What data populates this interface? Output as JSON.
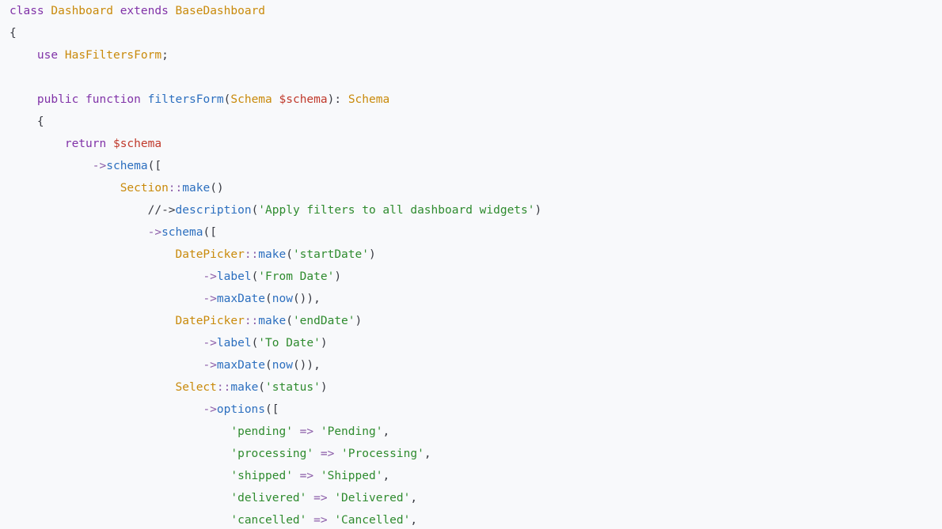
{
  "code": {
    "language": "php",
    "lines": [
      [
        {
          "t": "class",
          "c": "kw"
        },
        {
          "t": " ",
          "c": "punct"
        },
        {
          "t": "Dashboard",
          "c": "type"
        },
        {
          "t": " ",
          "c": "punct"
        },
        {
          "t": "extends",
          "c": "kw"
        },
        {
          "t": " ",
          "c": "punct"
        },
        {
          "t": "BaseDashboard",
          "c": "type"
        }
      ],
      [
        {
          "t": "{",
          "c": "punct"
        }
      ],
      [
        {
          "t": "    ",
          "c": "punct"
        },
        {
          "t": "use",
          "c": "kw"
        },
        {
          "t": " ",
          "c": "punct"
        },
        {
          "t": "HasFiltersForm",
          "c": "type"
        },
        {
          "t": ";",
          "c": "punct"
        }
      ],
      [],
      [
        {
          "t": "    ",
          "c": "punct"
        },
        {
          "t": "public",
          "c": "kw"
        },
        {
          "t": " ",
          "c": "punct"
        },
        {
          "t": "function",
          "c": "kw"
        },
        {
          "t": " ",
          "c": "punct"
        },
        {
          "t": "filtersForm",
          "c": "fn"
        },
        {
          "t": "(",
          "c": "punct"
        },
        {
          "t": "Schema",
          "c": "type"
        },
        {
          "t": " ",
          "c": "punct"
        },
        {
          "t": "$schema",
          "c": "var"
        },
        {
          "t": "): ",
          "c": "punct"
        },
        {
          "t": "Schema",
          "c": "type"
        }
      ],
      [
        {
          "t": "    {",
          "c": "punct"
        }
      ],
      [
        {
          "t": "        ",
          "c": "punct"
        },
        {
          "t": "return",
          "c": "kw"
        },
        {
          "t": " ",
          "c": "punct"
        },
        {
          "t": "$schema",
          "c": "var"
        }
      ],
      [
        {
          "t": "            ",
          "c": "punct"
        },
        {
          "t": "->",
          "c": "op"
        },
        {
          "t": "schema",
          "c": "fn"
        },
        {
          "t": "([",
          "c": "punct"
        }
      ],
      [
        {
          "t": "                ",
          "c": "punct"
        },
        {
          "t": "Section",
          "c": "type"
        },
        {
          "t": "::",
          "c": "op"
        },
        {
          "t": "make",
          "c": "fn"
        },
        {
          "t": "()",
          "c": "punct"
        }
      ],
      [
        {
          "t": "                    ",
          "c": "punct"
        },
        {
          "t": "//->",
          "c": "comment"
        },
        {
          "t": "description",
          "c": "fn"
        },
        {
          "t": "(",
          "c": "punct"
        },
        {
          "t": "'Apply filters to all dashboard widgets'",
          "c": "str"
        },
        {
          "t": ")",
          "c": "punct"
        }
      ],
      [
        {
          "t": "                    ",
          "c": "punct"
        },
        {
          "t": "->",
          "c": "op"
        },
        {
          "t": "schema",
          "c": "fn"
        },
        {
          "t": "([",
          "c": "punct"
        }
      ],
      [
        {
          "t": "                        ",
          "c": "punct"
        },
        {
          "t": "DatePicker",
          "c": "type"
        },
        {
          "t": "::",
          "c": "op"
        },
        {
          "t": "make",
          "c": "fn"
        },
        {
          "t": "(",
          "c": "punct"
        },
        {
          "t": "'startDate'",
          "c": "str"
        },
        {
          "t": ")",
          "c": "punct"
        }
      ],
      [
        {
          "t": "                            ",
          "c": "punct"
        },
        {
          "t": "->",
          "c": "op"
        },
        {
          "t": "label",
          "c": "fn"
        },
        {
          "t": "(",
          "c": "punct"
        },
        {
          "t": "'From Date'",
          "c": "str"
        },
        {
          "t": ")",
          "c": "punct"
        }
      ],
      [
        {
          "t": "                            ",
          "c": "punct"
        },
        {
          "t": "->",
          "c": "op"
        },
        {
          "t": "maxDate",
          "c": "fn"
        },
        {
          "t": "(",
          "c": "punct"
        },
        {
          "t": "now",
          "c": "fn"
        },
        {
          "t": "()),",
          "c": "punct"
        }
      ],
      [
        {
          "t": "                        ",
          "c": "punct"
        },
        {
          "t": "DatePicker",
          "c": "type"
        },
        {
          "t": "::",
          "c": "op"
        },
        {
          "t": "make",
          "c": "fn"
        },
        {
          "t": "(",
          "c": "punct"
        },
        {
          "t": "'endDate'",
          "c": "str"
        },
        {
          "t": ")",
          "c": "punct"
        }
      ],
      [
        {
          "t": "                            ",
          "c": "punct"
        },
        {
          "t": "->",
          "c": "op"
        },
        {
          "t": "label",
          "c": "fn"
        },
        {
          "t": "(",
          "c": "punct"
        },
        {
          "t": "'To Date'",
          "c": "str"
        },
        {
          "t": ")",
          "c": "punct"
        }
      ],
      [
        {
          "t": "                            ",
          "c": "punct"
        },
        {
          "t": "->",
          "c": "op"
        },
        {
          "t": "maxDate",
          "c": "fn"
        },
        {
          "t": "(",
          "c": "punct"
        },
        {
          "t": "now",
          "c": "fn"
        },
        {
          "t": "()),",
          "c": "punct"
        }
      ],
      [
        {
          "t": "                        ",
          "c": "punct"
        },
        {
          "t": "Select",
          "c": "type"
        },
        {
          "t": "::",
          "c": "op"
        },
        {
          "t": "make",
          "c": "fn"
        },
        {
          "t": "(",
          "c": "punct"
        },
        {
          "t": "'status'",
          "c": "str"
        },
        {
          "t": ")",
          "c": "punct"
        }
      ],
      [
        {
          "t": "                            ",
          "c": "punct"
        },
        {
          "t": "->",
          "c": "op"
        },
        {
          "t": "options",
          "c": "fn"
        },
        {
          "t": "([",
          "c": "punct"
        }
      ],
      [
        {
          "t": "                                ",
          "c": "punct"
        },
        {
          "t": "'pending'",
          "c": "str"
        },
        {
          "t": " => ",
          "c": "op"
        },
        {
          "t": "'Pending'",
          "c": "str"
        },
        {
          "t": ",",
          "c": "punct"
        }
      ],
      [
        {
          "t": "                                ",
          "c": "punct"
        },
        {
          "t": "'processing'",
          "c": "str"
        },
        {
          "t": " => ",
          "c": "op"
        },
        {
          "t": "'Processing'",
          "c": "str"
        },
        {
          "t": ",",
          "c": "punct"
        }
      ],
      [
        {
          "t": "                                ",
          "c": "punct"
        },
        {
          "t": "'shipped'",
          "c": "str"
        },
        {
          "t": " => ",
          "c": "op"
        },
        {
          "t": "'Shipped'",
          "c": "str"
        },
        {
          "t": ",",
          "c": "punct"
        }
      ],
      [
        {
          "t": "                                ",
          "c": "punct"
        },
        {
          "t": "'delivered'",
          "c": "str"
        },
        {
          "t": " => ",
          "c": "op"
        },
        {
          "t": "'Delivered'",
          "c": "str"
        },
        {
          "t": ",",
          "c": "punct"
        }
      ],
      [
        {
          "t": "                                ",
          "c": "punct"
        },
        {
          "t": "'cancelled'",
          "c": "str"
        },
        {
          "t": " => ",
          "c": "op"
        },
        {
          "t": "'Cancelled'",
          "c": "str"
        },
        {
          "t": ",",
          "c": "punct"
        }
      ]
    ]
  },
  "colors": {
    "background": "#f8f9fb",
    "keyword": "#8133a8",
    "type": "#c98a0b",
    "variable": "#c0392b",
    "function": "#2c6fbf",
    "string": "#2e8b2e",
    "operator": "#8b5ca8",
    "text": "#383a42"
  }
}
